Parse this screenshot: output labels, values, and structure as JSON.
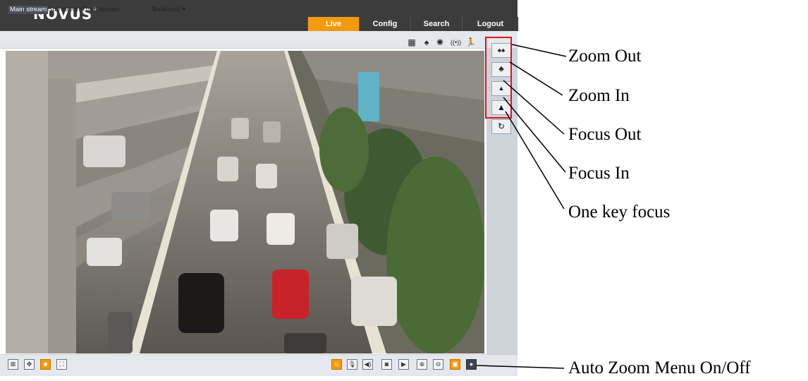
{
  "brand": {
    "logo": "NOVUS",
    "registered": "®"
  },
  "nav": {
    "items": [
      "Live",
      "Config",
      "Search",
      "Logout"
    ],
    "active": "Live",
    "active_color": "#f39a0f"
  },
  "streams": {
    "items": [
      "Main stream",
      "Sub stream",
      "Third stream"
    ],
    "active": "Main stream",
    "quality": "Balanced ▾"
  },
  "toolbar_icons": [
    "mosaic-icon",
    "alarm-bell-icon",
    "tamper-icon",
    "audio-wave-icon",
    "motion-person-icon"
  ],
  "ptz_buttons": [
    {
      "name": "zoom-out-button",
      "glyph": "♣♣",
      "label": "Zoom Out"
    },
    {
      "name": "zoom-in-button",
      "glyph": "♣",
      "label": "Zoom In"
    },
    {
      "name": "focus-out-button",
      "glyph": "▲",
      "label": "Focus Out"
    },
    {
      "name": "focus-in-button",
      "glyph": "▲",
      "label": "Focus In"
    },
    {
      "name": "one-key-focus-button",
      "glyph": "↻",
      "label": "One key focus"
    }
  ],
  "bottom_left_icons": [
    "original-size-icon",
    "fit-window-icon",
    "stretch-icon",
    "fullscreen-icon"
  ],
  "bottom_right_icons": [
    "talk-icon",
    "microphone-icon",
    "speaker-icon",
    "snapshot-icon",
    "record-icon",
    "digital-zoom-in-icon",
    "digital-zoom-out-icon",
    "auto-zoom-menu-icon",
    "ptz-toggle-icon"
  ],
  "callouts": {
    "zoom_out": "Zoom Out",
    "zoom_in": "Zoom In",
    "focus_out": "Focus Out",
    "focus_in": "Focus In",
    "one_key_focus": "One key focus",
    "auto_zoom": "Auto Zoom Menu On/Off"
  },
  "colors": {
    "highlight": "#e01020",
    "accent": "#f39a0f"
  }
}
